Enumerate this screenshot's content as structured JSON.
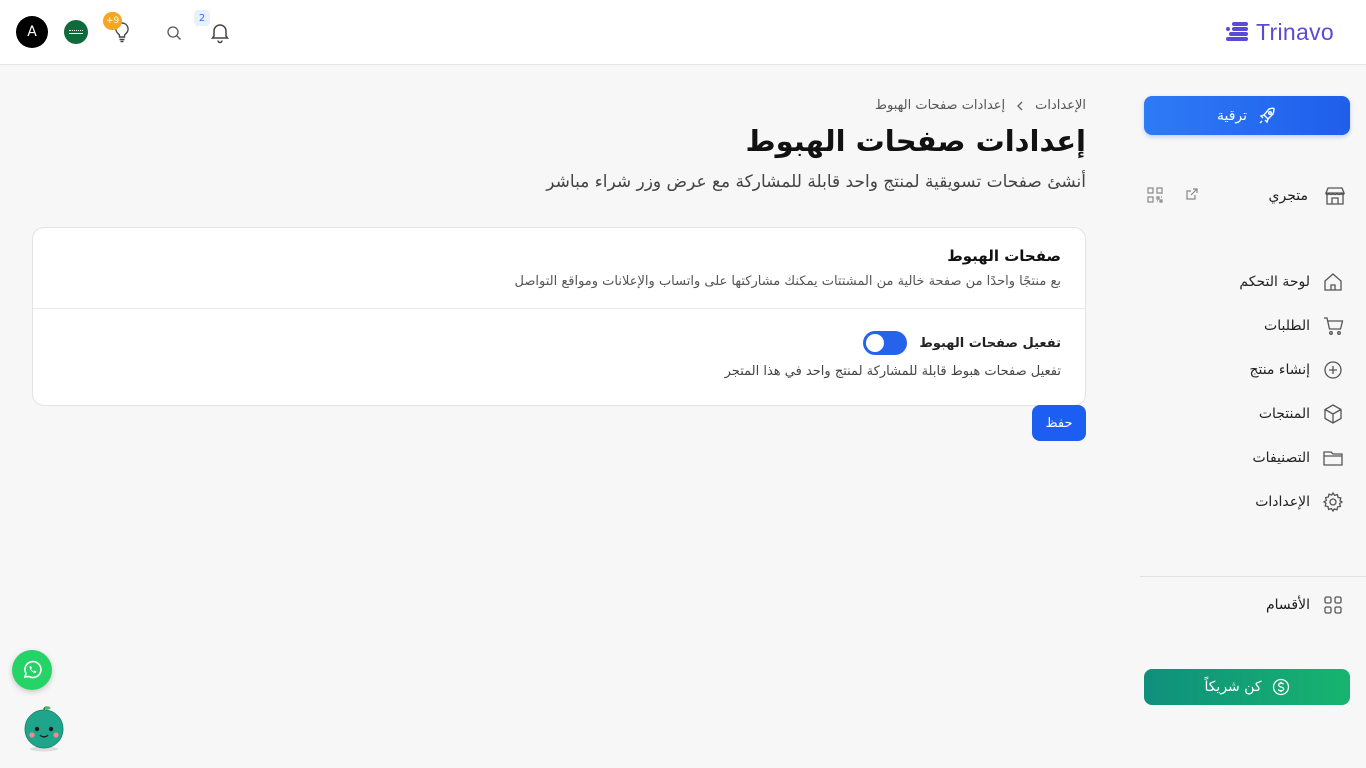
{
  "topbar": {
    "avatar_initial": "A",
    "bulb_badge": "+9",
    "notifications_badge": "2",
    "brand_name": "Trinavo"
  },
  "sidebar": {
    "upgrade_label": "ترقية",
    "store_label": "متجري",
    "nav": [
      {
        "label": "لوحة التحكم",
        "icon": "home-icon"
      },
      {
        "label": "الطلبات",
        "icon": "cart-icon"
      },
      {
        "label": "إنشاء منتج",
        "icon": "plus-circle-icon"
      },
      {
        "label": "المنتجات",
        "icon": "box-icon"
      },
      {
        "label": "التصنيفات",
        "icon": "folder-icon"
      },
      {
        "label": "الإعدادات",
        "icon": "gear-icon"
      }
    ],
    "sections_label": "الأقسام",
    "partner_label": "كن شريكاً"
  },
  "main": {
    "breadcrumb": [
      "الإعدادات",
      "إعدادات صفحات الهبوط"
    ],
    "title": "إعدادات صفحات الهبوط",
    "subtitle": "أنشئ صفحات تسويقية لمنتج واحد قابلة للمشاركة مع عرض وزر شراء مباشر",
    "card": {
      "title": "صفحات الهبوط",
      "description": "بع منتجًا واحدًا من صفحة خالية من المشتتات يمكنك مشاركتها على واتساب والإعلانات ومواقع التواصل",
      "toggle_label": "تفعيل صفحات الهبوط",
      "toggle_state": "on",
      "toggle_description": "تفعيل صفحات هبوط قابلة للمشاركة لمنتج واحد في هذا المتجر"
    },
    "save_label": "حفظ"
  },
  "colors": {
    "primary": "#1d5ef2",
    "brand": "#5b4ad6",
    "partner": "#17b46f",
    "whatsapp": "#25d366"
  }
}
